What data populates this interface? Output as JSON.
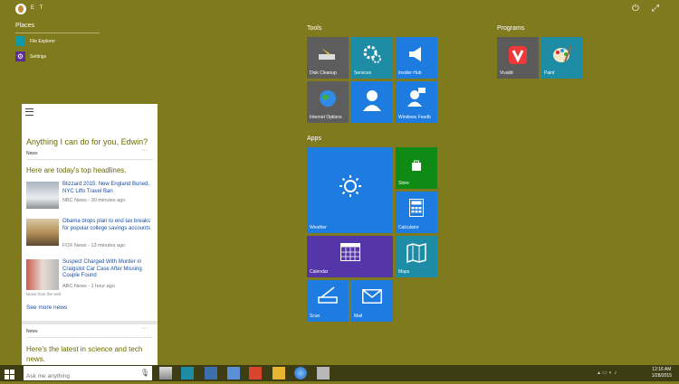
{
  "user": {
    "name": "E T"
  },
  "places": {
    "heading": "Places",
    "items": [
      {
        "label": "File Explorer",
        "color": "#0e9aa7"
      },
      {
        "label": "Settings",
        "color": "#5b2c9a"
      }
    ]
  },
  "groups": {
    "tools": "Tools",
    "programs": "Programs",
    "apps": "Apps"
  },
  "tiles": {
    "disk_cleanup": "Disk Cleanup",
    "services": "Services",
    "insider_hub": "Insider Hub",
    "internet_options": "Internet Options",
    "windows_feedback": "Windows Feedb",
    "vivaldi": "Vivaldi",
    "paint": "Paint",
    "weather": "Weather",
    "store": "Store",
    "calculator": "Calculator",
    "calendar": "Calendar",
    "maps": "Maps",
    "scan": "Scan",
    "mail": "Mail"
  },
  "colors": {
    "background": "#807a1e",
    "tile_gray": "#5d5d5d",
    "tile_teal": "#1e8ca5",
    "tile_blue": "#1e7ce0",
    "tile_green": "#0f8a14",
    "tile_purple": "#5536a8",
    "tile_vivaldi": "#5b5b5b"
  },
  "cortana": {
    "greeting": "Anything I can do for you, Edwin?",
    "section1_label": "News",
    "section1_heading": "Here are today's top headlines.",
    "articles": [
      {
        "title": "Blizzard 2015: New England Buried, NYC Lifts Travel Ban",
        "meta": "NBC News - 30 minutes ago"
      },
      {
        "title": "Obama drops plan to end tax breaks for popular college savings accounts",
        "meta": "FOX News - 13 minutes ago"
      },
      {
        "title": "Suspect Charged With Murder in Craigslist Car Case After Missing Couple Found",
        "meta": "ABC News - 1 hour ago"
      }
    ],
    "source_note": "News from the web",
    "see_more": "See more news",
    "section2_label": "News",
    "section2_heading": "Here's the latest in science and tech news."
  },
  "taskbar": {
    "search_placeholder": "Ask me anything",
    "time": "12:16 AM",
    "date": "1/28/2015"
  }
}
